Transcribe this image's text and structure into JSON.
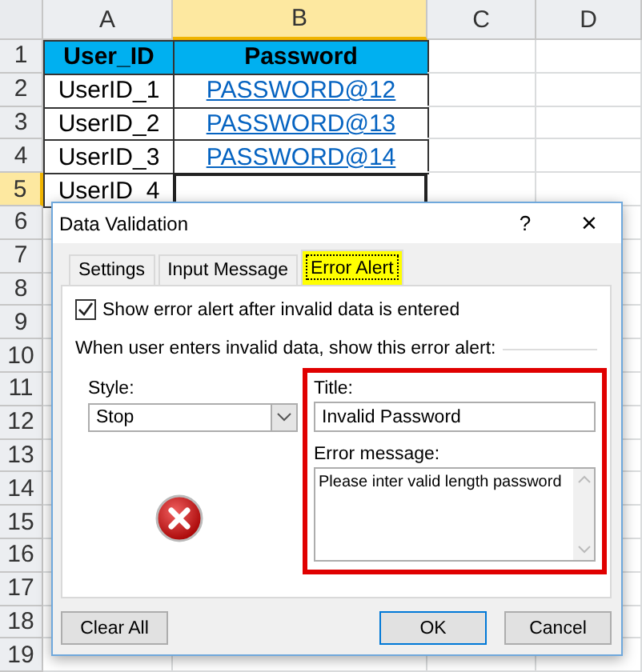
{
  "sheet": {
    "columns": [
      {
        "label": "A",
        "selected": false
      },
      {
        "label": "B",
        "selected": true
      },
      {
        "label": "C",
        "selected": false
      },
      {
        "label": "D",
        "selected": false
      }
    ],
    "rows": [
      {
        "number": "1",
        "selected": false,
        "cells": [
          {
            "kind": "header",
            "text": "User_ID",
            "selected": false
          },
          {
            "kind": "header",
            "text": "Password",
            "selected": false
          }
        ]
      },
      {
        "number": "2",
        "selected": false,
        "cells": [
          {
            "kind": "text",
            "text": "UserID_1",
            "selected": false
          },
          {
            "kind": "link",
            "text": "PASSWORD@12",
            "selected": false
          }
        ]
      },
      {
        "number": "3",
        "selected": false,
        "cells": [
          {
            "kind": "text",
            "text": "UserID_2",
            "selected": false
          },
          {
            "kind": "link",
            "text": "PASSWORD@13",
            "selected": false
          }
        ]
      },
      {
        "number": "4",
        "selected": false,
        "cells": [
          {
            "kind": "text",
            "text": "UserID_3",
            "selected": false
          },
          {
            "kind": "link",
            "text": "PASSWORD@14",
            "selected": false
          }
        ]
      },
      {
        "number": "5",
        "selected": true,
        "cells": [
          {
            "kind": "text",
            "text": "UserID_4",
            "selected": false
          },
          {
            "kind": "text",
            "text": "",
            "selected": true
          }
        ]
      },
      {
        "number": "6",
        "selected": false
      },
      {
        "number": "7",
        "selected": false
      },
      {
        "number": "8",
        "selected": false
      },
      {
        "number": "9",
        "selected": false
      },
      {
        "number": "10",
        "selected": false
      },
      {
        "number": "11",
        "selected": false
      },
      {
        "number": "12",
        "selected": false
      },
      {
        "number": "13",
        "selected": false
      },
      {
        "number": "14",
        "selected": false
      },
      {
        "number": "15",
        "selected": false
      },
      {
        "number": "16",
        "selected": false
      },
      {
        "number": "17",
        "selected": false
      },
      {
        "number": "18",
        "selected": false
      },
      {
        "number": "19",
        "selected": false
      }
    ]
  },
  "dialog": {
    "title": "Data Validation",
    "help": "?",
    "close": "×",
    "tabs": [
      {
        "label": "Settings",
        "selected": false
      },
      {
        "label": "Input Message",
        "selected": false
      },
      {
        "label": "Error Alert",
        "selected": true
      }
    ],
    "show_alert": {
      "label": "Show error alert after invalid data is entered",
      "checked": true
    },
    "group_label": "When user enters invalid data, show this error alert:",
    "style": {
      "label": "Style:",
      "value": "Stop"
    },
    "title_field": {
      "label": "Title:",
      "value": "Invalid Password"
    },
    "message_field": {
      "label": "Error message:",
      "value": "Please inter valid length password"
    },
    "buttons": [
      {
        "label": "Clear All",
        "kind": "secondary"
      },
      {
        "label": "OK",
        "kind": "default"
      },
      {
        "label": "Cancel",
        "kind": "secondary"
      }
    ]
  }
}
